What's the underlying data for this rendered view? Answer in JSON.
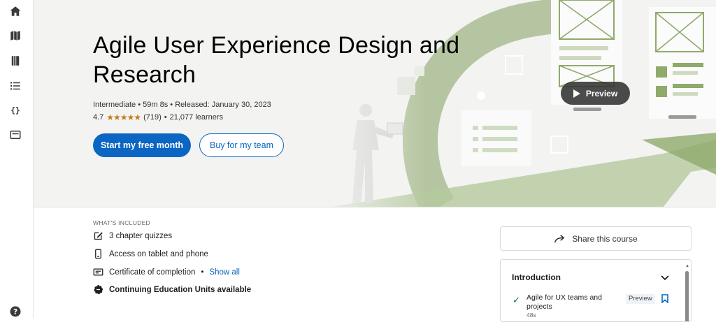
{
  "sidebar": {
    "icons": [
      "home-icon",
      "map-icon",
      "book-icon",
      "list-icon",
      "code-icon",
      "card-icon",
      "help-icon"
    ]
  },
  "hero": {
    "title": "Agile User Experience Design and Research",
    "level": "Intermediate",
    "duration": "59m 8s",
    "released": "Released: January 30, 2023",
    "rating": "4.7",
    "rating_fraction": 0.94,
    "rating_count": "(719)",
    "learners": "21,077 learners",
    "separator": "•",
    "start_button": "Start my free month",
    "team_button": "Buy for my team",
    "preview_button": "Preview"
  },
  "included": {
    "label": "WHAT'S INCLUDED",
    "items": [
      {
        "icon": "quiz-icon",
        "text": "3 chapter quizzes"
      },
      {
        "icon": "phone-icon",
        "text": "Access on tablet and phone"
      },
      {
        "icon": "certificate-icon",
        "text": "Certificate of completion",
        "link": "Show all"
      },
      {
        "icon": "badge-icon",
        "text": "Continuing Education Units available"
      }
    ]
  },
  "share": {
    "label": "Share this course"
  },
  "toc": {
    "section_title": "Introduction",
    "items": [
      {
        "title": "Agile for UX teams and projects",
        "duration": "48s",
        "badge": "Preview"
      }
    ]
  },
  "colors": {
    "accent": "#0a66c2",
    "star": "#c37d16",
    "art_green": "#8faa6b",
    "check_green": "#057642"
  }
}
